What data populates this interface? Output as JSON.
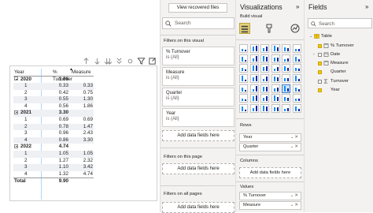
{
  "canvas": {
    "matrix": {
      "headers": [
        "Year",
        "% Turnover",
        "Measure"
      ],
      "rows": [
        {
          "label": "2020",
          "turnover": "1.86",
          "measure": "",
          "type": "group"
        },
        {
          "label": "1",
          "turnover": "0.33",
          "measure": "0.33",
          "type": "child"
        },
        {
          "label": "2",
          "turnover": "0.42",
          "measure": "0.75",
          "type": "child"
        },
        {
          "label": "3",
          "turnover": "0.55",
          "measure": "1.30",
          "type": "child"
        },
        {
          "label": "4",
          "turnover": "0.56",
          "measure": "1.86",
          "type": "child"
        },
        {
          "label": "2021",
          "turnover": "3.30",
          "measure": "",
          "type": "group"
        },
        {
          "label": "1",
          "turnover": "0.69",
          "measure": "0.69",
          "type": "child"
        },
        {
          "label": "2",
          "turnover": "0.78",
          "measure": "1.47",
          "type": "child"
        },
        {
          "label": "3",
          "turnover": "0.96",
          "measure": "2.43",
          "type": "child"
        },
        {
          "label": "4",
          "turnover": "0.86",
          "measure": "3.30",
          "type": "child"
        },
        {
          "label": "2022",
          "turnover": "4.74",
          "measure": "",
          "type": "group"
        },
        {
          "label": "1",
          "turnover": "1.05",
          "measure": "1.05",
          "type": "child"
        },
        {
          "label": "2",
          "turnover": "1.27",
          "measure": "2.32",
          "type": "child"
        },
        {
          "label": "3",
          "turnover": "1.10",
          "measure": "3.42",
          "type": "child"
        },
        {
          "label": "4",
          "turnover": "1.32",
          "measure": "4.74",
          "type": "child"
        }
      ],
      "total": {
        "label": "Total",
        "turnover": "9.90",
        "measure": ""
      }
    }
  },
  "filters": {
    "recover_label": "View recovered files",
    "search_placeholder": "Search",
    "on_visual_title": "Filters on this visual",
    "cards": [
      {
        "name": "% Turnover",
        "value": "is (All)"
      },
      {
        "name": "Measure",
        "value": "is (All)"
      },
      {
        "name": "Quarter",
        "value": "is (All)"
      },
      {
        "name": "Year",
        "value": "is (All)"
      }
    ],
    "add_label": "Add data fields here",
    "on_page_title": "Filters on this page",
    "all_pages_title": "Filters on all pages"
  },
  "viz": {
    "title": "Visualizations",
    "collapse": "»",
    "build_label": "Build visual",
    "rows_label": "Rows",
    "rows": [
      "Year",
      "Quarter"
    ],
    "columns_label": "Columns",
    "columns_add": "Add data fields here",
    "values_label": "Values",
    "values": [
      "% Turnover",
      "Measure"
    ]
  },
  "fields": {
    "title": "Fields",
    "collapse": "»",
    "search_placeholder": "Search",
    "table_name": "Table",
    "items": [
      {
        "name": "% Turnover",
        "checked": true,
        "kind": "measure"
      },
      {
        "name": "Date",
        "checked": false,
        "kind": "date"
      },
      {
        "name": "Measure",
        "checked": true,
        "kind": "measure"
      },
      {
        "name": "Quarter",
        "checked": true,
        "kind": "field"
      },
      {
        "name": "Turnover",
        "checked": false,
        "kind": "sigma"
      },
      {
        "name": "Year",
        "checked": true,
        "kind": "field"
      }
    ]
  }
}
